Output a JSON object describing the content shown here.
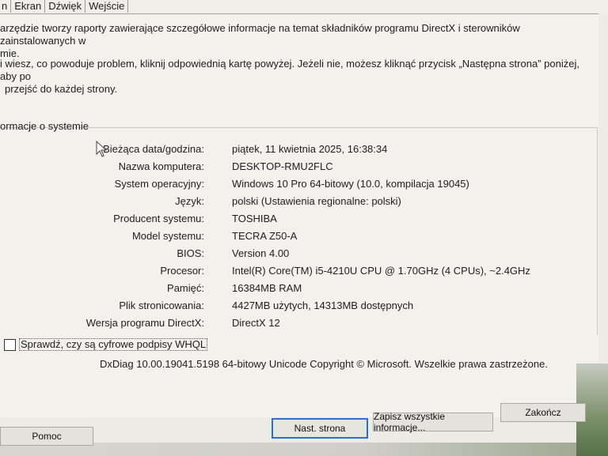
{
  "tabs": [
    "n",
    "Ekran",
    "Dźwięk",
    "Wejście"
  ],
  "intro": {
    "line1": "arzędzie tworzy raporty zawierające szczegółowe informacje na temat składników programu DirectX i sterowników zainstalowanych w",
    "line1b": "mie.",
    "line2": "i wiesz, co powoduje problem, kliknij odpowiednią kartę powyżej. Jeżeli nie, możesz kliknąć przycisk „Następna strona” poniżej, aby po",
    "line2b": "przejść do każdej strony."
  },
  "system_info": {
    "group_label": "ormacje o systemie",
    "rows": [
      {
        "label": "Bieżąca data/godzina:",
        "value": "piątek, 11 kwietnia 2025, 16:38:34"
      },
      {
        "label": "Nazwa komputera:",
        "value": "DESKTOP-RMU2FLC"
      },
      {
        "label": "System operacyjny:",
        "value": "Windows 10 Pro 64-bitowy (10.0, kompilacja 19045)"
      },
      {
        "label": "Język:",
        "value": "polski (Ustawienia regionalne: polski)"
      },
      {
        "label": "Producent systemu:",
        "value": "TOSHIBA"
      },
      {
        "label": "Model systemu:",
        "value": "TECRA Z50-A"
      },
      {
        "label": "BIOS:",
        "value": "Version 4.00"
      },
      {
        "label": "Procesor:",
        "value": "Intel(R) Core(TM) i5-4210U CPU @ 1.70GHz (4 CPUs), ~2.4GHz"
      },
      {
        "label": "Pamięć:",
        "value": "16384MB RAM"
      },
      {
        "label": "Plik stronicowania:",
        "value": "4427MB użytych, 14313MB dostępnych"
      },
      {
        "label": "Wersja programu DirectX:",
        "value": "DirectX 12"
      }
    ]
  },
  "whql_check": {
    "label": "Sprawdź, czy są cyfrowe podpisy WHQL",
    "checked": false
  },
  "copyright": "DxDiag 10.00.19041.5198 64-bitowy Unicode  Copyright © Microsoft. Wszelkie prawa zastrzeżone.",
  "buttons": {
    "help": "Pomoc",
    "next": "Nast. strona",
    "save": "Zapisz wszystkie informacje...",
    "exit": "Zakończ"
  },
  "colors": {
    "focus_border": "#2a6ed1",
    "panel_bg": "#f2f1ec"
  }
}
